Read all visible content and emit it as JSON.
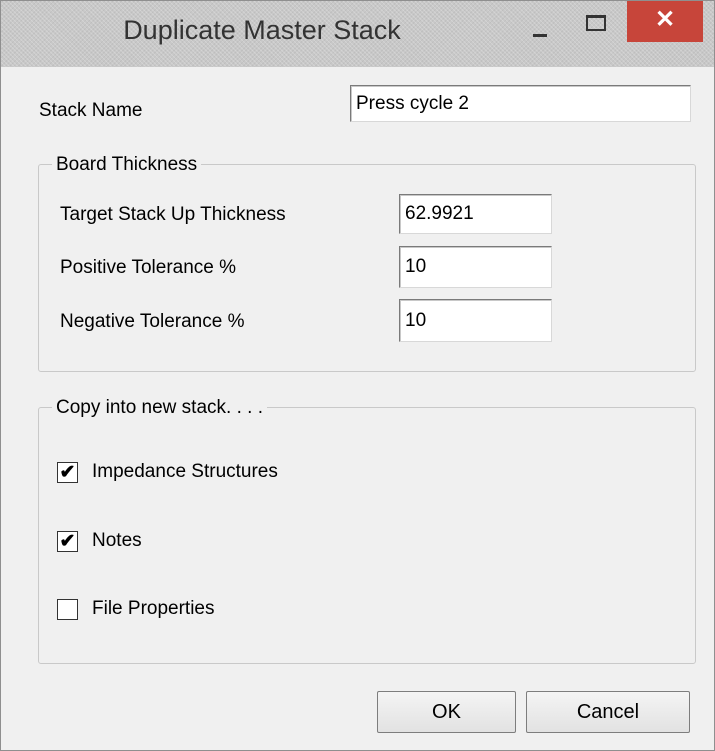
{
  "window": {
    "title": "Duplicate Master Stack",
    "close_glyph": "✕"
  },
  "stack_name": {
    "label": "Stack Name",
    "value": "Press cycle 2"
  },
  "board_thickness": {
    "legend": "Board Thickness",
    "fields": [
      {
        "label": "Target Stack Up Thickness",
        "value": "62.9921"
      },
      {
        "label": "Positive Tolerance %",
        "value": "10"
      },
      {
        "label": "Negative Tolerance %",
        "value": "10"
      }
    ]
  },
  "copy_options": {
    "legend": "Copy into new stack. . . .",
    "items": [
      {
        "label": "Impedance Structures",
        "checked": true,
        "mark": "✔"
      },
      {
        "label": "Notes",
        "checked": true,
        "mark": "✔"
      },
      {
        "label": "File Properties",
        "checked": false,
        "mark": ""
      }
    ]
  },
  "buttons": {
    "ok": "OK",
    "cancel": "Cancel"
  }
}
